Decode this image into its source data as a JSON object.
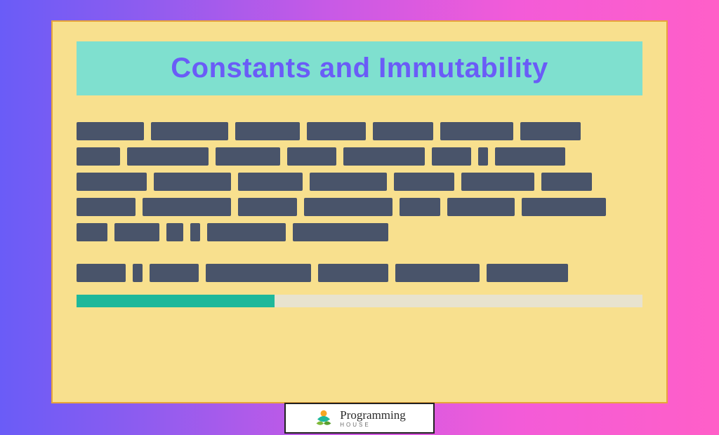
{
  "title": "Constants and Immutability",
  "paragraph_lines": [
    [
      96,
      110,
      92,
      84,
      86,
      104,
      86
    ],
    [
      62,
      116,
      92,
      70,
      116,
      56,
      14,
      100
    ],
    [
      100,
      110,
      92,
      110,
      86,
      104,
      72
    ],
    [
      84,
      126,
      84,
      126,
      58,
      96,
      120
    ],
    [
      44,
      64,
      24,
      14,
      112,
      136
    ]
  ],
  "paragraph_line_2": [
    [
      70,
      14,
      70,
      150,
      100,
      120,
      116
    ]
  ],
  "progress_percent": 35,
  "brand": {
    "name": "Programming",
    "sub": "HOUSE"
  },
  "colors": {
    "word": "#49546a",
    "progress": "#1fb89a"
  }
}
